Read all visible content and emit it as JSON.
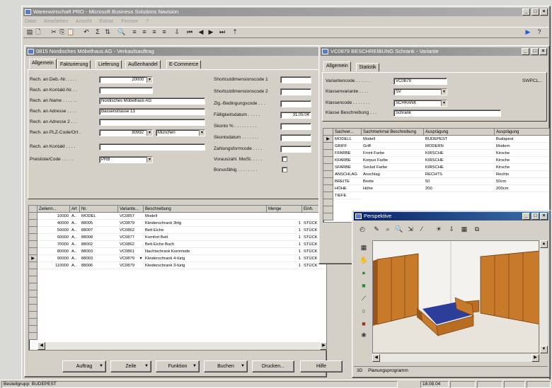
{
  "app": {
    "title": "Warenwirtschaft PRO - Microsoft Business Solutions Navision",
    "menu": [
      "Datei",
      "Bearbeiten",
      "Ansicht",
      "Extras",
      "Fenster",
      "?"
    ],
    "window_controls": [
      "_",
      "□",
      "×"
    ]
  },
  "toolbar": {
    "icons": [
      "print-icon",
      "preview-icon",
      "cut-icon",
      "copy-icon",
      "paste-icon",
      "undo-icon",
      "filter-icon",
      "sort-icon",
      "find-icon",
      "list-icon",
      "first-icon",
      "prev-icon",
      "next-icon",
      "last-icon",
      "zoom-icon"
    ],
    "glyphs": [
      "▤",
      "🗋",
      "✂",
      "⎘",
      "📋",
      "↶",
      "Σ",
      "⇅",
      "🔍",
      "≡",
      "⏮",
      "◀",
      "▶",
      "⏭",
      "⇩"
    ],
    "right_glyphs": [
      "▶",
      "?"
    ]
  },
  "order": {
    "title": "0815 Nordisches Möbelhaus AG - Verkaufsauftrag",
    "tabs": [
      "Allgemein",
      "Fakturierung",
      "Lieferung",
      "Außenhandel",
      "E-Commerce"
    ],
    "fields": [
      {
        "label": "Rech. an Deb.-Nr. . . . .",
        "value": "20000"
      },
      {
        "label": "Rech. an Kontakt-Nr. . .",
        "value": ""
      },
      {
        "label": "Rech. an Name . . . . . .",
        "value": "Nordisches Möbelhaus AG"
      },
      {
        "label": "Rech. an Adresse . . . .",
        "value": "Bassenstrasse 13"
      },
      {
        "label": "Rech. an Adresse 2 . . .",
        "value": ""
      },
      {
        "label": "Rech. an PLZ-Code/Ort .",
        "value": "80992",
        "value2": "München"
      },
      {
        "label": "Rech. an Kontakt . . . .",
        "value": ""
      },
      {
        "label": "Preisliste/Code . . . . .",
        "value": "PRB"
      }
    ],
    "right_fields": [
      {
        "label": "Shortcutdimensionscode 1",
        "value": ""
      },
      {
        "label": "Shortcutdimensionscode 2",
        "value": ""
      },
      {
        "label": "Zlg.-Bedingungscode . . .",
        "value": ""
      },
      {
        "label": "Fälligkeitsdatum . . . . .",
        "value": "31.05.04"
      },
      {
        "label": "Skonto % . . . . . . . . .",
        "value": ""
      },
      {
        "label": "Skontodatum . . . . . . .",
        "value": ""
      },
      {
        "label": "Zahlungsformcode . . . .",
        "value": ""
      },
      {
        "label": "Vorauszahl. MwSt. . . . .",
        "check": true
      },
      {
        "label": "Bonusfähig . . . . . . . .",
        "check": true
      }
    ],
    "lines": {
      "headers": [
        "Zeilenn...",
        "Art",
        "Nr.",
        "Variante...",
        "Beschreibung",
        "Menge",
        "Einh."
      ],
      "rows": [
        {
          "zeile": "10000",
          "art": "A..",
          "nr": "MODEL",
          "var": "VC0857",
          "desc": "Modell",
          "menge": "",
          "einh": ""
        },
        {
          "zeile": "40000",
          "art": "A..",
          "nr": "88005",
          "var": "VC0879",
          "desc": "Kleiderschrank 3trlg",
          "menge": "1",
          "einh": "STÜCK"
        },
        {
          "zeile": "50000",
          "art": "A..",
          "nr": "88007",
          "var": "VC0862",
          "desc": "Bett Eiche",
          "menge": "1",
          "einh": "STÜCK"
        },
        {
          "zeile": "60000",
          "art": "A..",
          "nr": "88008",
          "var": "VC0877",
          "desc": "Komfort Bett",
          "menge": "1",
          "einh": "STÜCK"
        },
        {
          "zeile": "70000",
          "art": "A..",
          "nr": "88002",
          "var": "VC0862",
          "desc": "Bett Eiche Buch",
          "menge": "1",
          "einh": "STÜCK"
        },
        {
          "zeile": "80000",
          "art": "A..",
          "nr": "88003",
          "var": "VC0861",
          "desc": "Nachtschrank Kommode",
          "menge": "1",
          "einh": "STÜCK"
        },
        {
          "zeile": "90000",
          "art": "A..",
          "nr": "88003",
          "var": "VC0879",
          "desc": "Kleiderschrank 4-türig",
          "menge": "1",
          "einh": "STÜCK"
        },
        {
          "zeile": "110000",
          "art": "A..",
          "nr": "88006",
          "var": "VC0879",
          "desc": "Kleiderschrank 3-türig",
          "menge": "1",
          "einh": "STÜCK"
        }
      ]
    },
    "buttons": [
      "Auftrag",
      "Zeile",
      "Funktion",
      "Buchen",
      "Drucken...",
      "Hilfe"
    ]
  },
  "variant": {
    "title": "VC0879 BESCHREIBUNG Schrank - Variante",
    "tabs": [
      "Allgemein",
      "Statistik"
    ],
    "fields": [
      {
        "label": "Variantencode . . . . . .",
        "value": "VC0879"
      },
      {
        "label": "Klassenvariante . . . .",
        "value": "SV"
      },
      {
        "label": "Klassencode . . . . . . .",
        "value": "SCHRANK"
      },
      {
        "label": "Klasse Beschreibung . . .",
        "value": "Schrank"
      }
    ],
    "side_label": "SWPCL...",
    "grid": {
      "headers": [
        "Sachver...",
        "Sachmerkmal Beschreibung",
        "Ausprägung",
        "Ausprägung"
      ],
      "rows": [
        [
          "MODELL",
          "Modell",
          "BUDEPEST",
          "Budapest"
        ],
        [
          "GRIFF",
          "Griff",
          "MODERN",
          "Modern"
        ],
        [
          "FFARBE",
          "Front Farbe",
          "KIRSCHE",
          "Kirsche"
        ],
        [
          "KFARBE",
          "Korpus Farbe",
          "KIRSCHE",
          "Kirsche"
        ],
        [
          "SFARBE",
          "Sockel Farbe",
          "KIRSCHE",
          "Kirsche"
        ],
        [
          "ANSCHLAG",
          "Anschlag",
          "RECHTS",
          "Rechts"
        ],
        [
          "BREITE",
          "Breite",
          "50",
          "50cm"
        ],
        [
          "HÖHE",
          "Höhe",
          "200",
          "200cm"
        ],
        [
          "TIEFE",
          "",
          "",
          ""
        ]
      ]
    }
  },
  "viewer": {
    "title": "Perspektive",
    "icons": [
      "rotate-icon",
      "pencil-icon",
      "zoom-icon",
      "search-icon",
      "move-icon",
      "brush-icon",
      "light-icon",
      "camera-icon",
      "grid-icon",
      "window-icon"
    ],
    "glyphs": [
      "◴",
      "✎",
      "⌕",
      "🔍",
      "⇲",
      "⁄",
      "☀",
      "⇩",
      "▦",
      "⧉"
    ],
    "tool_icons": [
      "layers-icon",
      "hand-icon",
      "green-tool-icon",
      "green-tool-2-icon",
      "line-icon",
      "circle-icon",
      "brown-icon",
      "texture-icon"
    ],
    "tool_glyphs": [
      "▦",
      "✋",
      "●",
      "■",
      "⟋",
      "○",
      "■",
      "❀"
    ],
    "status": "Planungsprogramm",
    "status_prefix": "3D"
  },
  "statusbar": {
    "left": "Bestellgrupp: BUDEPEST",
    "date": "18.08.04"
  }
}
